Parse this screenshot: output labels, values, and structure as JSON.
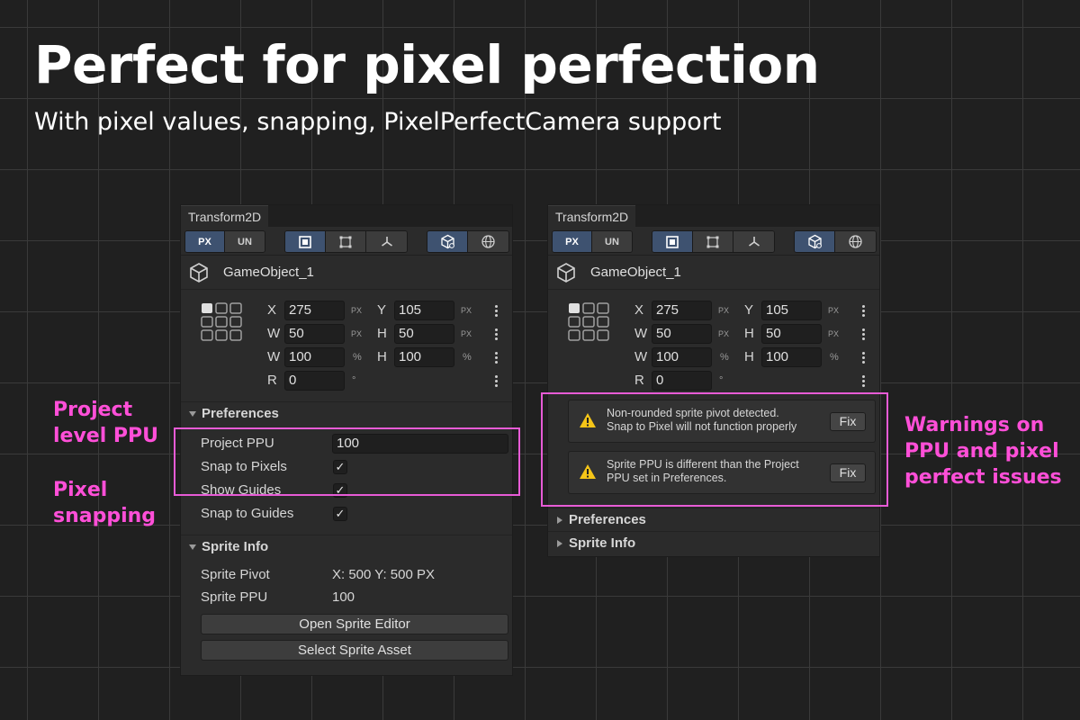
{
  "hero": {
    "title": "Perfect for pixel perfection",
    "subtitle": "With pixel values, snapping, PixelPerfectCamera support"
  },
  "callouts": {
    "project_ppu": [
      "Project",
      "level PPU"
    ],
    "pixel_snapping": [
      "Pixel",
      "snapping"
    ],
    "warnings": [
      "Warnings on",
      "PPU and pixel",
      "perfect issues"
    ]
  },
  "colors": {
    "accent": "#ff4fd8",
    "active_button": "#3e5270",
    "warning": "#f5c518"
  },
  "toolbar": {
    "unit_px": "PX",
    "unit_un": "UN",
    "icons": [
      "rect-tool-icon",
      "resize-tool-icon",
      "pivot-tool-icon",
      "local-space-icon",
      "world-space-icon"
    ]
  },
  "left_panel": {
    "tab": "Transform2D",
    "object_name": "GameObject_1",
    "fields": {
      "x_label": "X",
      "x_value": "275",
      "x_unit": "PX",
      "y_label": "Y",
      "y_value": "105",
      "y_unit": "PX",
      "w_label": "W",
      "w_value": "50",
      "w_unit": "PX",
      "h_label": "H",
      "h_value": "50",
      "h_unit": "PX",
      "wp_label": "W",
      "wp_value": "100",
      "wp_unit": "%",
      "hp_label": "H",
      "hp_value": "100",
      "hp_unit": "%",
      "r_label": "R",
      "r_value": "0",
      "r_unit": "°"
    },
    "preferences": {
      "title": "Preferences",
      "project_ppu_label": "Project PPU",
      "project_ppu_value": "100",
      "snap_to_pixels": "Snap to Pixels",
      "show_guides": "Show Guides",
      "snap_to_guides": "Snap to Guides",
      "check": "✓"
    },
    "sprite_info": {
      "title": "Sprite Info",
      "pivot_label": "Sprite Pivot",
      "pivot_value": "X: 500  Y: 500 PX",
      "ppu_label": "Sprite PPU",
      "ppu_value": "100",
      "open_editor": "Open Sprite Editor",
      "select_asset": "Select Sprite Asset"
    }
  },
  "right_panel": {
    "tab": "Transform2D",
    "object_name": "GameObject_1",
    "fields": {
      "x_label": "X",
      "x_value": "275",
      "x_unit": "PX",
      "y_label": "Y",
      "y_value": "105",
      "y_unit": "PX",
      "w_label": "W",
      "w_value": "50",
      "w_unit": "PX",
      "h_label": "H",
      "h_value": "50",
      "h_unit": "PX",
      "wp_label": "W",
      "wp_value": "100",
      "wp_unit": "%",
      "hp_label": "H",
      "hp_value": "100",
      "hp_unit": "%",
      "r_label": "R",
      "r_value": "0",
      "r_unit": "°"
    },
    "warnings": [
      {
        "line1": "Non-rounded sprite pivot detected.",
        "line2": "Snap to Pixel will not function properly",
        "fix": "Fix"
      },
      {
        "line1": "Sprite PPU is different than the Project",
        "line2": "PPU set in Preferences.",
        "fix": "Fix"
      }
    ],
    "preferences_title": "Preferences",
    "sprite_info_title": "Sprite Info"
  }
}
